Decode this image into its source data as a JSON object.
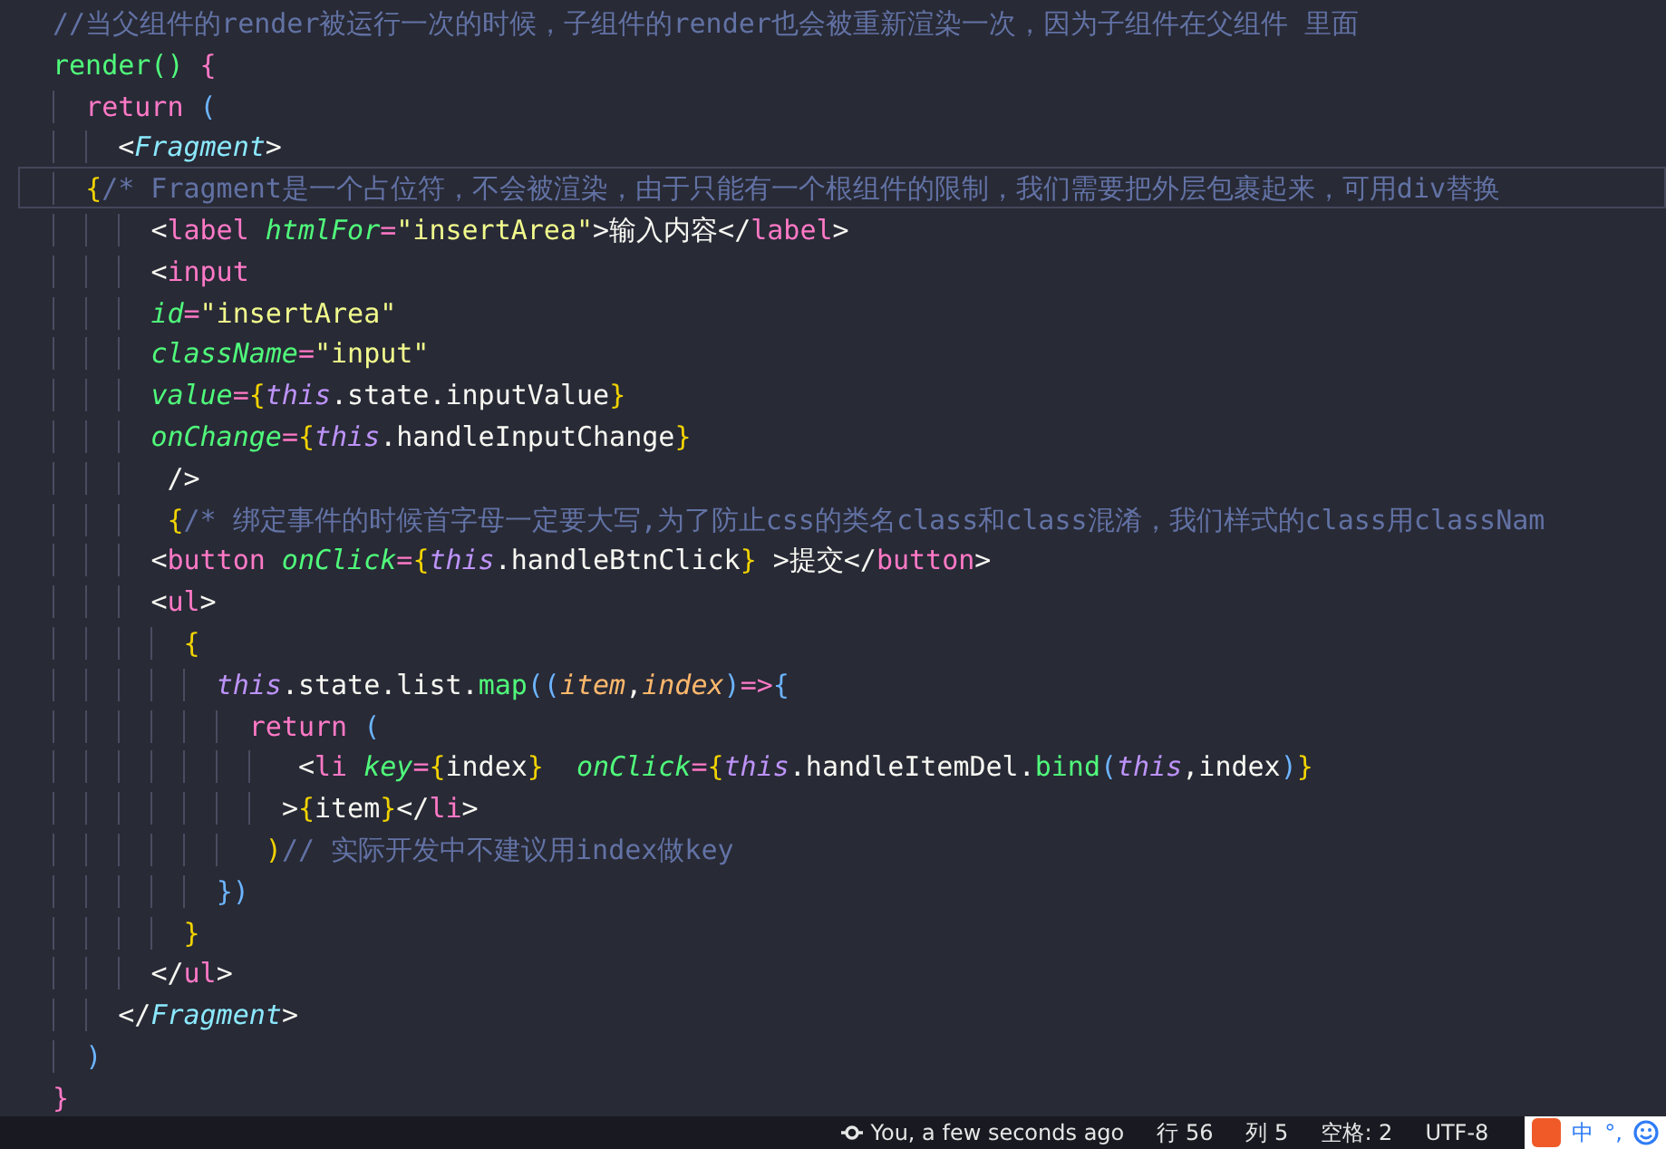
{
  "editor": {
    "lines": [
      {
        "current": false,
        "tokens": [
          {
            "kind": "cm",
            "text": "//当父组件的render被运行一次的时候，子组件的render也会被重新渲染一次，因为子组件在父组件 里面"
          }
        ]
      },
      {
        "current": false,
        "tokens": [
          {
            "kind": "fn",
            "text": "render()"
          },
          {
            "kind": "kw",
            "text": " {"
          }
        ]
      },
      {
        "current": false,
        "tokens": [
          {
            "kind": "kw",
            "text": "  return"
          },
          {
            "kind": "pa",
            "text": " ("
          }
        ]
      },
      {
        "current": false,
        "tokens": [
          {
            "kind": "pn",
            "text": "    <"
          },
          {
            "kind": "cp",
            "text": "Fragment"
          },
          {
            "kind": "pn",
            "text": ">"
          }
        ]
      },
      {
        "current": true,
        "tokens": [
          {
            "kind": "br",
            "text": "  {"
          },
          {
            "kind": "cm",
            "text": "/* Fragment是一个占位符，不会被渲染，由于只能有一个根组件的限制，我们需要把外层包裹起来，可用div替换"
          }
        ]
      },
      {
        "current": false,
        "tokens": [
          {
            "kind": "pn",
            "text": "      <"
          },
          {
            "kind": "tg",
            "text": "label"
          },
          {
            "kind": "at",
            "text": " htmlFor"
          },
          {
            "kind": "op",
            "text": "="
          },
          {
            "kind": "st",
            "text": "\"insertArea\""
          },
          {
            "kind": "pn",
            "text": ">输入内容</"
          },
          {
            "kind": "tg",
            "text": "label"
          },
          {
            "kind": "pn",
            "text": ">"
          }
        ]
      },
      {
        "current": false,
        "tokens": [
          {
            "kind": "pn",
            "text": "      <"
          },
          {
            "kind": "tg",
            "text": "input"
          }
        ]
      },
      {
        "current": false,
        "tokens": [
          {
            "kind": "at",
            "text": "      id"
          },
          {
            "kind": "op",
            "text": "="
          },
          {
            "kind": "st",
            "text": "\"insertArea\""
          }
        ]
      },
      {
        "current": false,
        "tokens": [
          {
            "kind": "at",
            "text": "      className"
          },
          {
            "kind": "op",
            "text": "="
          },
          {
            "kind": "st",
            "text": "\"input\""
          }
        ]
      },
      {
        "current": false,
        "tokens": [
          {
            "kind": "at",
            "text": "      value"
          },
          {
            "kind": "op",
            "text": "="
          },
          {
            "kind": "br",
            "text": "{"
          },
          {
            "kind": "th",
            "text": "this"
          },
          {
            "kind": "pn",
            "text": ".state.inputValue"
          },
          {
            "kind": "br",
            "text": "}"
          }
        ]
      },
      {
        "current": false,
        "tokens": [
          {
            "kind": "at",
            "text": "      onChange"
          },
          {
            "kind": "op",
            "text": "="
          },
          {
            "kind": "br",
            "text": "{"
          },
          {
            "kind": "th",
            "text": "this"
          },
          {
            "kind": "pn",
            "text": ".handleInputChange"
          },
          {
            "kind": "br",
            "text": "}"
          }
        ]
      },
      {
        "current": false,
        "tokens": [
          {
            "kind": "pn",
            "text": "       />"
          }
        ]
      },
      {
        "current": false,
        "tokens": [
          {
            "kind": "br",
            "text": "       {"
          },
          {
            "kind": "cm",
            "text": "/* 绑定事件的时候首字母一定要大写,为了防止css的类名class和class混淆，我们样式的class用classNam"
          }
        ]
      },
      {
        "current": false,
        "tokens": [
          {
            "kind": "pn",
            "text": "      <"
          },
          {
            "kind": "tg",
            "text": "button"
          },
          {
            "kind": "at",
            "text": " onClick"
          },
          {
            "kind": "op",
            "text": "="
          },
          {
            "kind": "br",
            "text": "{"
          },
          {
            "kind": "th",
            "text": "this"
          },
          {
            "kind": "pn",
            "text": ".handleBtnClick"
          },
          {
            "kind": "br",
            "text": "}"
          },
          {
            "kind": "pn",
            "text": " >提交</"
          },
          {
            "kind": "tg",
            "text": "button"
          },
          {
            "kind": "pn",
            "text": ">"
          }
        ]
      },
      {
        "current": false,
        "tokens": [
          {
            "kind": "pn",
            "text": "      <"
          },
          {
            "kind": "tg",
            "text": "ul"
          },
          {
            "kind": "pn",
            "text": ">"
          }
        ]
      },
      {
        "current": false,
        "tokens": [
          {
            "kind": "br",
            "text": "        {"
          }
        ]
      },
      {
        "current": false,
        "tokens": [
          {
            "kind": "th",
            "text": "          this"
          },
          {
            "kind": "pn",
            "text": ".state.list."
          },
          {
            "kind": "fn",
            "text": "map"
          },
          {
            "kind": "pa",
            "text": "(("
          },
          {
            "kind": "pr",
            "text": "item"
          },
          {
            "kind": "pn",
            "text": ","
          },
          {
            "kind": "pr",
            "text": "index"
          },
          {
            "kind": "pa",
            "text": ")"
          },
          {
            "kind": "op",
            "text": "=>"
          },
          {
            "kind": "pa",
            "text": "{"
          }
        ]
      },
      {
        "current": false,
        "tokens": [
          {
            "kind": "kw",
            "text": "            return"
          },
          {
            "kind": "pa",
            "text": " ("
          }
        ]
      },
      {
        "current": false,
        "tokens": [
          {
            "kind": "pn",
            "text": "               <"
          },
          {
            "kind": "tg",
            "text": "li"
          },
          {
            "kind": "at",
            "text": " key"
          },
          {
            "kind": "op",
            "text": "="
          },
          {
            "kind": "br",
            "text": "{"
          },
          {
            "kind": "pn",
            "text": "index"
          },
          {
            "kind": "br",
            "text": "}"
          },
          {
            "kind": "at",
            "text": "  onClick"
          },
          {
            "kind": "op",
            "text": "="
          },
          {
            "kind": "br",
            "text": "{"
          },
          {
            "kind": "th",
            "text": "this"
          },
          {
            "kind": "pn",
            "text": ".handleItemDel."
          },
          {
            "kind": "fn",
            "text": "bind"
          },
          {
            "kind": "pa",
            "text": "("
          },
          {
            "kind": "th",
            "text": "this"
          },
          {
            "kind": "pn",
            "text": ",index"
          },
          {
            "kind": "pa",
            "text": ")"
          },
          {
            "kind": "br",
            "text": "}"
          }
        ]
      },
      {
        "current": false,
        "tokens": [
          {
            "kind": "pn",
            "text": "              >"
          },
          {
            "kind": "br",
            "text": "{"
          },
          {
            "kind": "pn",
            "text": "item"
          },
          {
            "kind": "br",
            "text": "}"
          },
          {
            "kind": "pn",
            "text": "</"
          },
          {
            "kind": "tg",
            "text": "li"
          },
          {
            "kind": "pn",
            "text": ">"
          }
        ]
      },
      {
        "current": false,
        "tokens": [
          {
            "kind": "br",
            "text": "             )"
          },
          {
            "kind": "cm",
            "text": "// 实际开发中不建议用index做key"
          }
        ]
      },
      {
        "current": false,
        "tokens": [
          {
            "kind": "pa",
            "text": "          })"
          }
        ]
      },
      {
        "current": false,
        "tokens": [
          {
            "kind": "br",
            "text": "        }"
          }
        ]
      },
      {
        "current": false,
        "tokens": [
          {
            "kind": "pn",
            "text": "      </"
          },
          {
            "kind": "tg",
            "text": "ul"
          },
          {
            "kind": "pn",
            "text": ">"
          }
        ]
      },
      {
        "current": false,
        "tokens": [
          {
            "kind": "pn",
            "text": "    </"
          },
          {
            "kind": "cp",
            "text": "Fragment"
          },
          {
            "kind": "pn",
            "text": ">"
          }
        ]
      },
      {
        "current": false,
        "tokens": [
          {
            "kind": "pa",
            "text": "  )"
          }
        ]
      },
      {
        "current": false,
        "tokens": [
          {
            "kind": "kw",
            "text": "}"
          }
        ]
      }
    ]
  },
  "status_bar": {
    "items": [
      {
        "kind": "git",
        "text": "You, a few seconds ago"
      },
      {
        "kind": "plain",
        "text": "行 56"
      },
      {
        "kind": "plain",
        "text": "列 5"
      },
      {
        "kind": "plain",
        "text": "空格: 2"
      },
      {
        "kind": "plain",
        "text": "UTF-8"
      }
    ],
    "ime": [
      "中",
      "°,"
    ]
  }
}
